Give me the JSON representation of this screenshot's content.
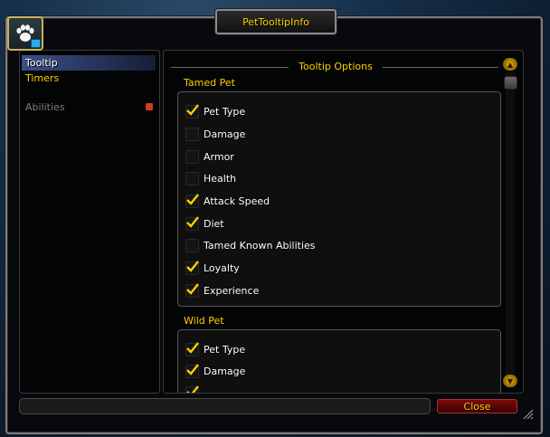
{
  "window": {
    "title": "PetTooltipInfo",
    "portrait_icon": "paw-icon"
  },
  "sidebar": {
    "items": [
      {
        "label": "Tooltip",
        "state": "selected"
      },
      {
        "label": "Timers",
        "state": "normal"
      },
      {
        "label": "Abilities",
        "state": "disabled",
        "has_arrow": true
      }
    ]
  },
  "main": {
    "header": "Tooltip Options",
    "sections": [
      {
        "label": "Tamed Pet",
        "options": [
          {
            "label": "Pet Type",
            "checked": true
          },
          {
            "label": "Damage",
            "checked": false
          },
          {
            "label": "Armor",
            "checked": false
          },
          {
            "label": "Health",
            "checked": false
          },
          {
            "label": "Attack Speed",
            "checked": true
          },
          {
            "label": "Diet",
            "checked": true
          },
          {
            "label": "Tamed Known Abilities",
            "checked": false
          },
          {
            "label": "Loyalty",
            "checked": true
          },
          {
            "label": "Experience",
            "checked": true
          }
        ]
      },
      {
        "label": "Wild Pet",
        "options": [
          {
            "label": "Pet Type",
            "checked": true
          },
          {
            "label": "Damage",
            "checked": true
          },
          {
            "label": "",
            "checked": true
          }
        ]
      }
    ]
  },
  "footer": {
    "close_label": "Close",
    "status_text": ""
  },
  "colors": {
    "gold": "#ffd100",
    "close_red": "#7a0a0a",
    "nav_selected": "#3d4f8a"
  }
}
